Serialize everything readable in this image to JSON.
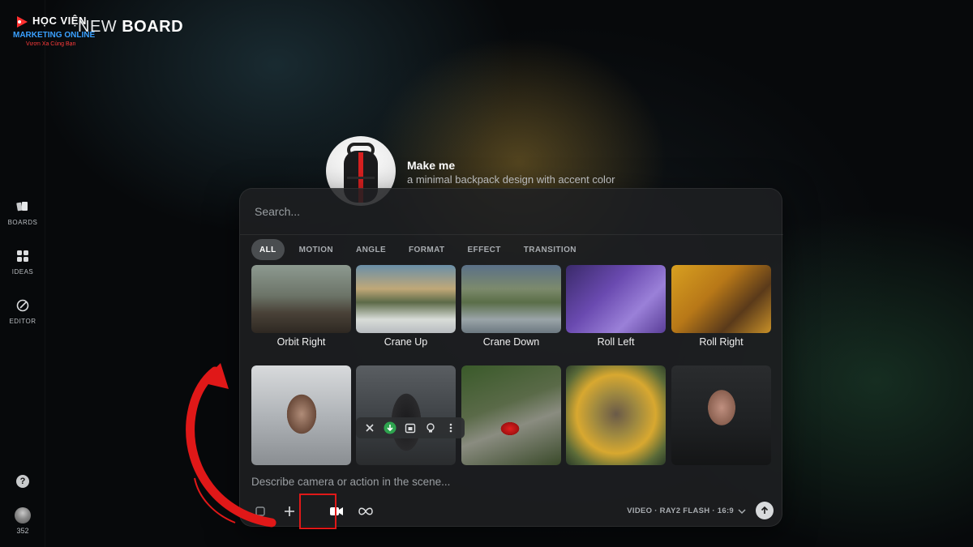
{
  "brand": {
    "line1": "HỌC VIỆN",
    "line2": "MARKETING ONLINE",
    "line3": "Vươn Xa Cùng Bạn"
  },
  "header": {
    "title_word1": "NEW",
    "title_word2": "BOARD"
  },
  "sidebar": {
    "items": [
      {
        "label": "BOARDS",
        "icon": "boards-icon"
      },
      {
        "label": "IDEAS",
        "icon": "ideas-icon"
      },
      {
        "label": "EDITOR",
        "icon": "editor-icon"
      }
    ],
    "help_label": "?",
    "credits": "352"
  },
  "prompt_card": {
    "title": "Make me",
    "subtitle": "a minimal backpack design with accent color"
  },
  "panel": {
    "search_placeholder": "Search...",
    "tabs": [
      {
        "label": "ALL",
        "active": true
      },
      {
        "label": "MOTION",
        "active": false
      },
      {
        "label": "ANGLE",
        "active": false
      },
      {
        "label": "FORMAT",
        "active": false
      },
      {
        "label": "EFFECT",
        "active": false
      },
      {
        "label": "TRANSITION",
        "active": false
      }
    ],
    "row1": [
      {
        "label": "Orbit Right"
      },
      {
        "label": "Crane Up"
      },
      {
        "label": "Crane Down"
      },
      {
        "label": "Roll Left"
      },
      {
        "label": "Roll Right"
      }
    ],
    "row2_count": 5,
    "scene_placeholder": "Describe camera or action in the scene...",
    "model_label": "VIDEO · RAY2 FLASH · 16:9"
  },
  "colors": {
    "accent_red": "#e01818",
    "tab_active_bg": "#4a4d50",
    "panel_bg": "#1e2022"
  }
}
